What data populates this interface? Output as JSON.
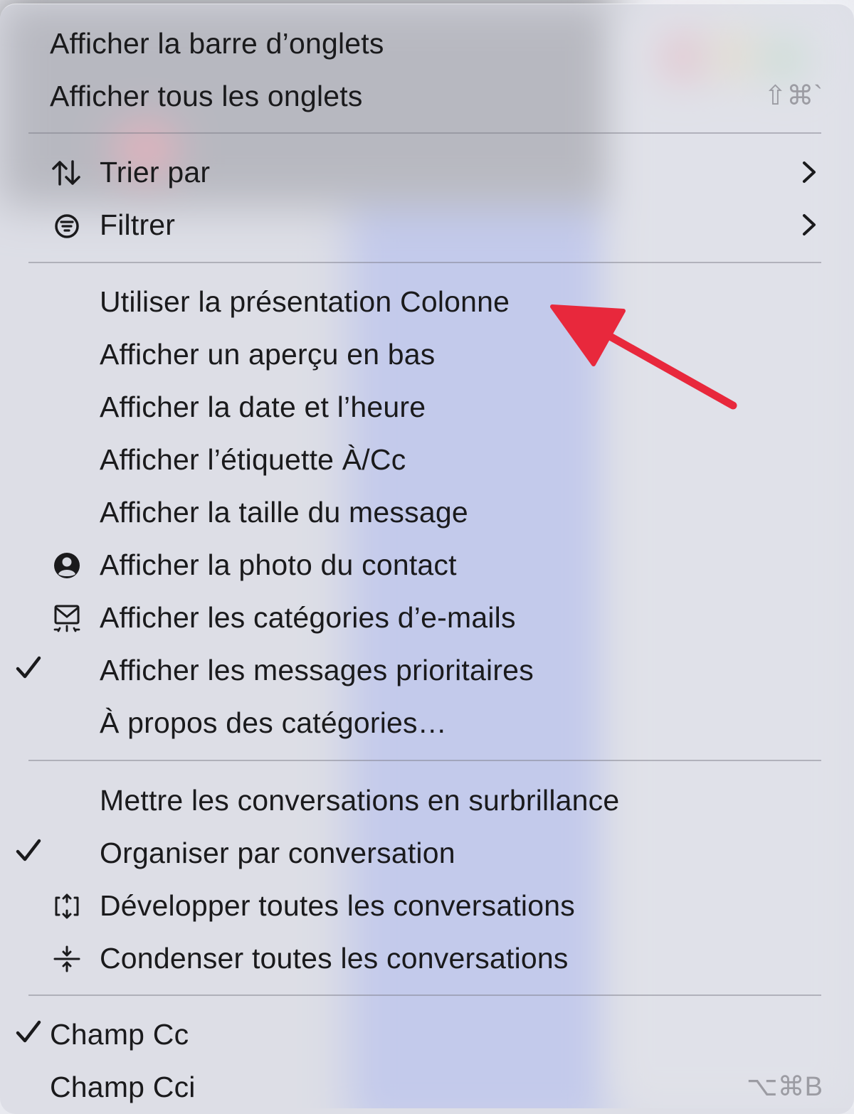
{
  "menu": {
    "items": [
      {
        "label": "Afficher la barre d’onglets"
      },
      {
        "label": "Afficher tous les onglets",
        "shortcut": "⇧⌘`"
      },
      {
        "label": "Trier par",
        "icon": "sort-arrows-icon",
        "submenu": true
      },
      {
        "label": "Filtrer",
        "icon": "filter-icon",
        "submenu": true
      },
      {
        "label": "Utiliser la présentation Colonne"
      },
      {
        "label": "Afficher un aperçu en bas"
      },
      {
        "label": "Afficher la date et l’heure"
      },
      {
        "label": "Afficher l’étiquette À/Cc"
      },
      {
        "label": "Afficher la taille du message"
      },
      {
        "label": "Afficher la photo du contact",
        "icon": "contact-photo-icon"
      },
      {
        "label": "Afficher les catégories d’e-mails",
        "icon": "mail-categories-icon"
      },
      {
        "label": "Afficher les messages prioritaires",
        "checked": true
      },
      {
        "label": "À propos des catégories…"
      },
      {
        "label": "Mettre les conversations en surbrillance"
      },
      {
        "label": "Organiser par conversation",
        "checked": true
      },
      {
        "label": "Développer toutes les conversations",
        "icon": "expand-icon"
      },
      {
        "label": "Condenser toutes les conversations",
        "icon": "collapse-icon"
      },
      {
        "label": "Champ Cc",
        "checked": true
      },
      {
        "label": "Champ Cci",
        "shortcut": "⌥⌘B"
      }
    ]
  },
  "annotation": {
    "color": "#e8283c",
    "icon": "red-arrow-icon"
  }
}
